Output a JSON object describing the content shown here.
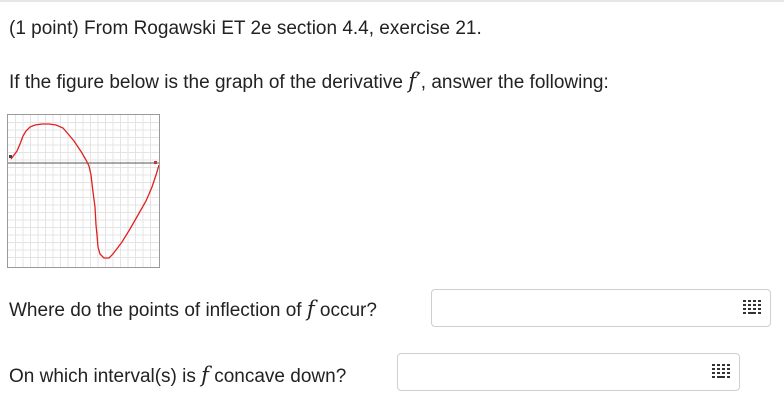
{
  "problem": {
    "header": "(1 point) From Rogawski ET 2e section 4.4, exercise 21.",
    "prompt_before": "If the figure below is the graph of the derivative ",
    "prompt_math": "f′",
    "prompt_after": ", answer the following:"
  },
  "questions": [
    {
      "before": "Where do the points of inflection of ",
      "math": "f",
      "after": " occur?",
      "value": "",
      "placeholder": ""
    },
    {
      "before": "On which interval(s) is ",
      "math": "f",
      "after": " concave down?",
      "value": "",
      "placeholder": ""
    }
  ],
  "icons": {
    "answer_palette": "keypad-grid-icon"
  },
  "colors": {
    "curve": "#e02020",
    "grid": "#e4e4e4",
    "axis": "#555555",
    "field_border": "#cfcfcf"
  }
}
